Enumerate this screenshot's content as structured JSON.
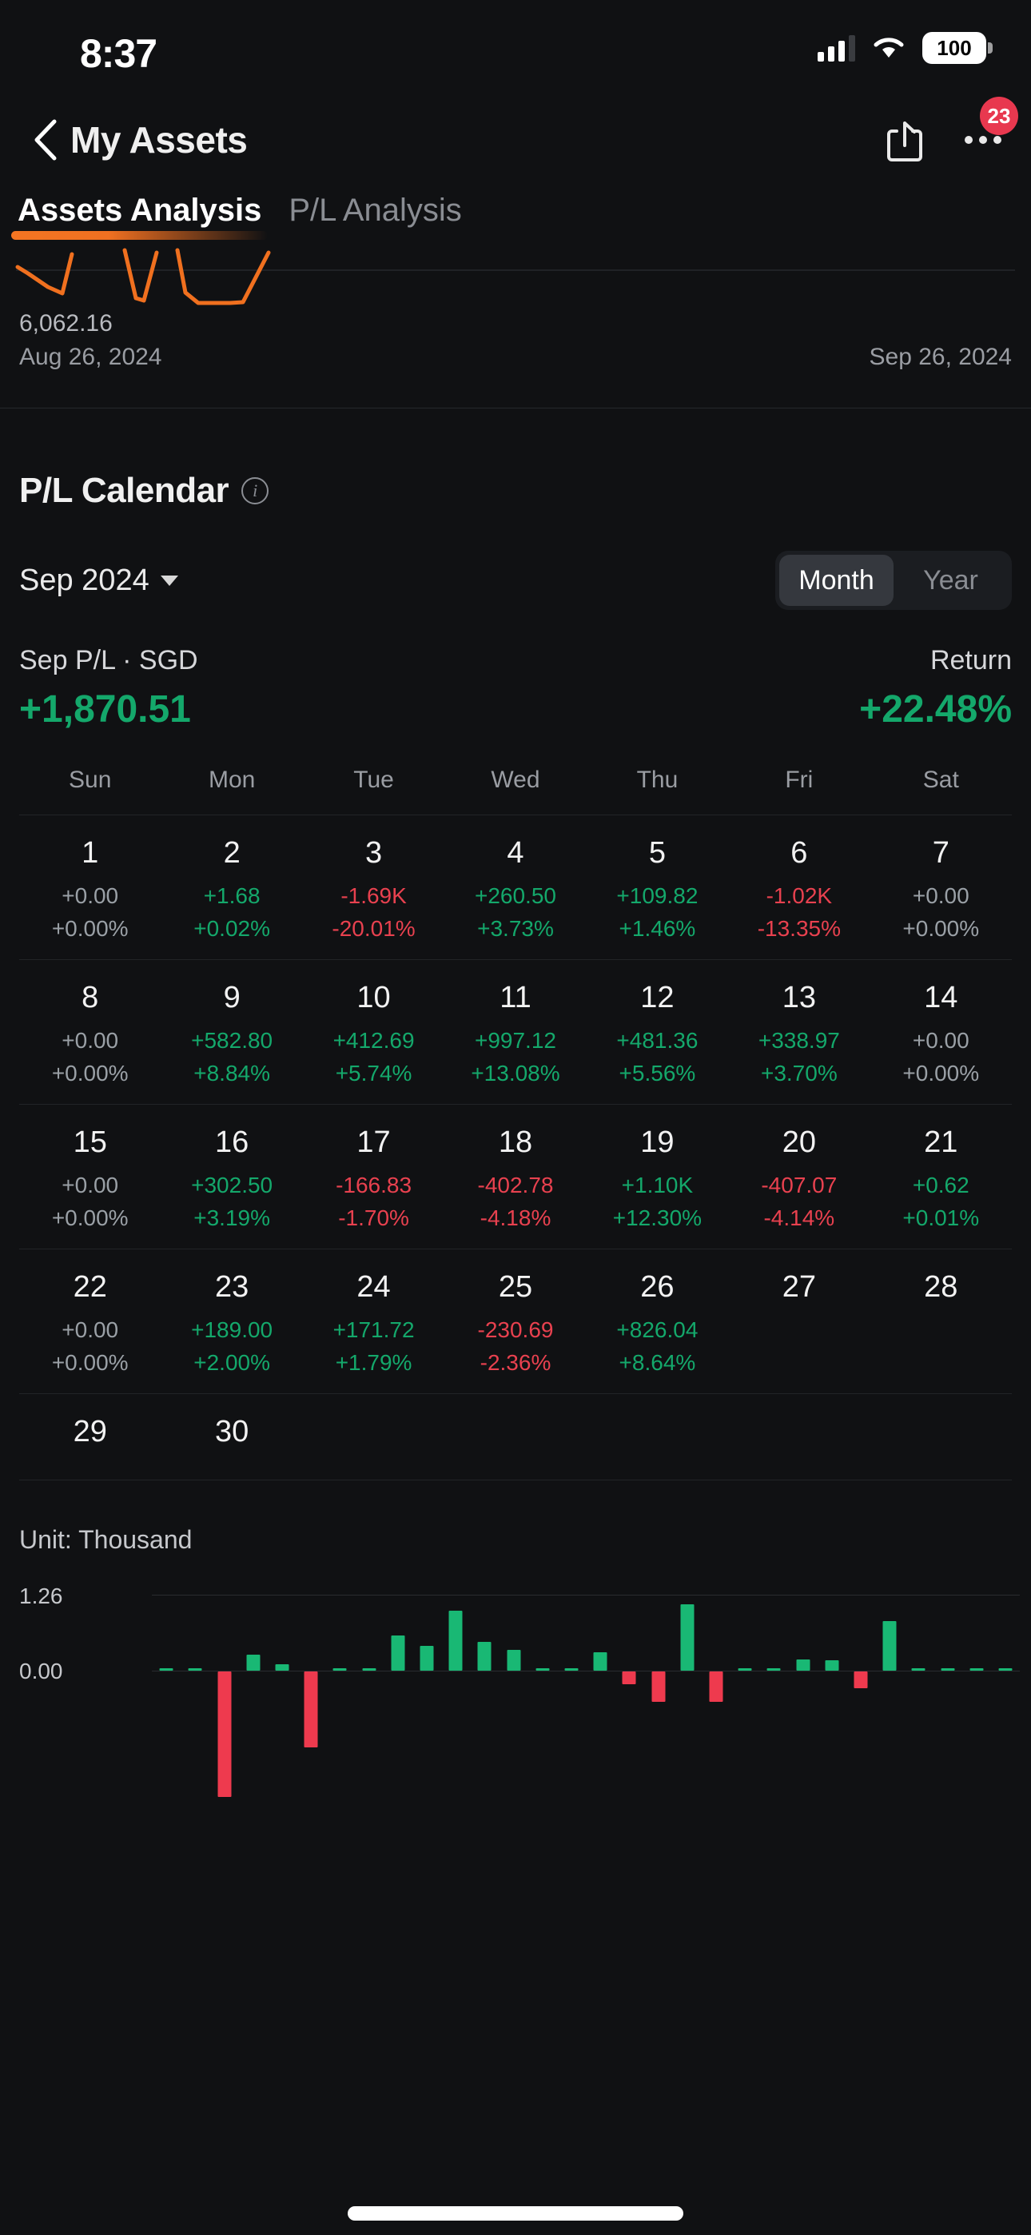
{
  "status_bar": {
    "time": "8:37",
    "battery_level": "100",
    "signal_icon": "cellular-signal-icon",
    "wifi_icon": "wifi-icon",
    "battery_icon": "battery-icon"
  },
  "nav": {
    "back_icon": "chevron-left-icon",
    "title": "My Assets",
    "share_icon": "share-icon",
    "more_icon": "more-options-icon",
    "badge_count": "23"
  },
  "tabs": [
    {
      "label": "Assets Analysis",
      "active": true
    },
    {
      "label": "P/L Analysis",
      "active": false
    }
  ],
  "mini_chart": {
    "value_label": "6,062.16",
    "start_date": "Aug 26, 2024",
    "end_date": "Sep 26, 2024",
    "line_color": "#F0701F"
  },
  "pl_calendar": {
    "title": "P/L Calendar",
    "info_icon": "info-icon",
    "month_selector": "Sep 2024",
    "caret_icon": "chevron-down-icon",
    "range_options": [
      {
        "label": "Month",
        "selected": true
      },
      {
        "label": "Year",
        "selected": false
      }
    ],
    "summary": {
      "pl_label": "Sep P/L · SGD",
      "pl_value": "+1,870.51",
      "pl_sign": "pos",
      "return_label": "Return",
      "return_value": "+22.48%",
      "return_sign": "pos"
    },
    "day_headers": [
      "Sun",
      "Mon",
      "Tue",
      "Wed",
      "Thu",
      "Fri",
      "Sat"
    ],
    "weeks": [
      [
        {
          "day": "1",
          "value": "+0.00",
          "pct": "+0.00%",
          "sign": "zero"
        },
        {
          "day": "2",
          "value": "+1.68",
          "pct": "+0.02%",
          "sign": "pos"
        },
        {
          "day": "3",
          "value": "-1.69K",
          "pct": "-20.01%",
          "sign": "neg"
        },
        {
          "day": "4",
          "value": "+260.50",
          "pct": "+3.73%",
          "sign": "pos"
        },
        {
          "day": "5",
          "value": "+109.82",
          "pct": "+1.46%",
          "sign": "pos"
        },
        {
          "day": "6",
          "value": "-1.02K",
          "pct": "-13.35%",
          "sign": "neg"
        },
        {
          "day": "7",
          "value": "+0.00",
          "pct": "+0.00%",
          "sign": "zero"
        }
      ],
      [
        {
          "day": "8",
          "value": "+0.00",
          "pct": "+0.00%",
          "sign": "zero"
        },
        {
          "day": "9",
          "value": "+582.80",
          "pct": "+8.84%",
          "sign": "pos"
        },
        {
          "day": "10",
          "value": "+412.69",
          "pct": "+5.74%",
          "sign": "pos"
        },
        {
          "day": "11",
          "value": "+997.12",
          "pct": "+13.08%",
          "sign": "pos"
        },
        {
          "day": "12",
          "value": "+481.36",
          "pct": "+5.56%",
          "sign": "pos"
        },
        {
          "day": "13",
          "value": "+338.97",
          "pct": "+3.70%",
          "sign": "pos"
        },
        {
          "day": "14",
          "value": "+0.00",
          "pct": "+0.00%",
          "sign": "zero"
        }
      ],
      [
        {
          "day": "15",
          "value": "+0.00",
          "pct": "+0.00%",
          "sign": "zero"
        },
        {
          "day": "16",
          "value": "+302.50",
          "pct": "+3.19%",
          "sign": "pos"
        },
        {
          "day": "17",
          "value": "-166.83",
          "pct": "-1.70%",
          "sign": "neg"
        },
        {
          "day": "18",
          "value": "-402.78",
          "pct": "-4.18%",
          "sign": "neg"
        },
        {
          "day": "19",
          "value": "+1.10K",
          "pct": "+12.30%",
          "sign": "pos"
        },
        {
          "day": "20",
          "value": "-407.07",
          "pct": "-4.14%",
          "sign": "neg"
        },
        {
          "day": "21",
          "value": "+0.62",
          "pct": "+0.01%",
          "sign": "pos"
        }
      ],
      [
        {
          "day": "22",
          "value": "+0.00",
          "pct": "+0.00%",
          "sign": "zero"
        },
        {
          "day": "23",
          "value": "+189.00",
          "pct": "+2.00%",
          "sign": "pos"
        },
        {
          "day": "24",
          "value": "+171.72",
          "pct": "+1.79%",
          "sign": "pos"
        },
        {
          "day": "25",
          "value": "-230.69",
          "pct": "-2.36%",
          "sign": "neg"
        },
        {
          "day": "26",
          "value": "+826.04",
          "pct": "+8.64%",
          "sign": "pos"
        },
        {
          "day": "27",
          "value": "",
          "pct": "",
          "sign": "zero"
        },
        {
          "day": "28",
          "value": "",
          "pct": "",
          "sign": "zero"
        }
      ],
      [
        {
          "day": "29",
          "value": "",
          "pct": "",
          "sign": "zero"
        },
        {
          "day": "30",
          "value": "",
          "pct": "",
          "sign": "zero"
        },
        {
          "day": "",
          "value": "",
          "pct": "",
          "sign": "zero"
        },
        {
          "day": "",
          "value": "",
          "pct": "",
          "sign": "zero"
        },
        {
          "day": "",
          "value": "",
          "pct": "",
          "sign": "zero"
        },
        {
          "day": "",
          "value": "",
          "pct": "",
          "sign": "zero"
        },
        {
          "day": "",
          "value": "",
          "pct": "",
          "sign": "zero"
        }
      ]
    ]
  },
  "bar_section": {
    "unit_label": "Unit: Thousand",
    "positive_color": "#19B874",
    "negative_color": "#EE3A4E"
  },
  "chart_data": [
    {
      "type": "line",
      "title": "Assets Analysis",
      "xlabel": "",
      "ylabel": "",
      "x": [
        "Aug 26, 2024",
        "Sep 26, 2024"
      ],
      "tick_labels": [
        "6,062.16"
      ],
      "line_color": "#F0701F",
      "note": "partially scrolled off-screen net-asset line chart"
    },
    {
      "type": "bar",
      "title": "Daily P/L",
      "unit_label": "Unit: Thousand",
      "ylabel": "",
      "xlabel": "",
      "ylim": [
        -1.69,
        1.26
      ],
      "ytick_labels": [
        "1.26",
        "0.00"
      ],
      "grid": true,
      "categories": [
        "1",
        "2",
        "3",
        "4",
        "5",
        "6",
        "7",
        "8",
        "9",
        "10",
        "11",
        "12",
        "13",
        "14",
        "15",
        "16",
        "17",
        "18",
        "19",
        "20",
        "21",
        "22",
        "23",
        "24",
        "25",
        "26",
        "27",
        "28",
        "29",
        "30"
      ],
      "values": [
        0.0,
        0.00168,
        -1.69,
        0.2605,
        0.10982,
        -1.02,
        0.0,
        0.0,
        0.5828,
        0.41269,
        0.99712,
        0.48136,
        0.33897,
        0.0,
        0.0,
        0.3025,
        -0.16683,
        -0.40278,
        1.1,
        -0.40707,
        0.00062,
        0.0,
        0.189,
        0.17172,
        -0.23069,
        0.82604,
        0.0,
        0.0,
        0.0,
        0.0
      ],
      "positive_color": "#19B874",
      "negative_color": "#EE3A4E"
    }
  ]
}
